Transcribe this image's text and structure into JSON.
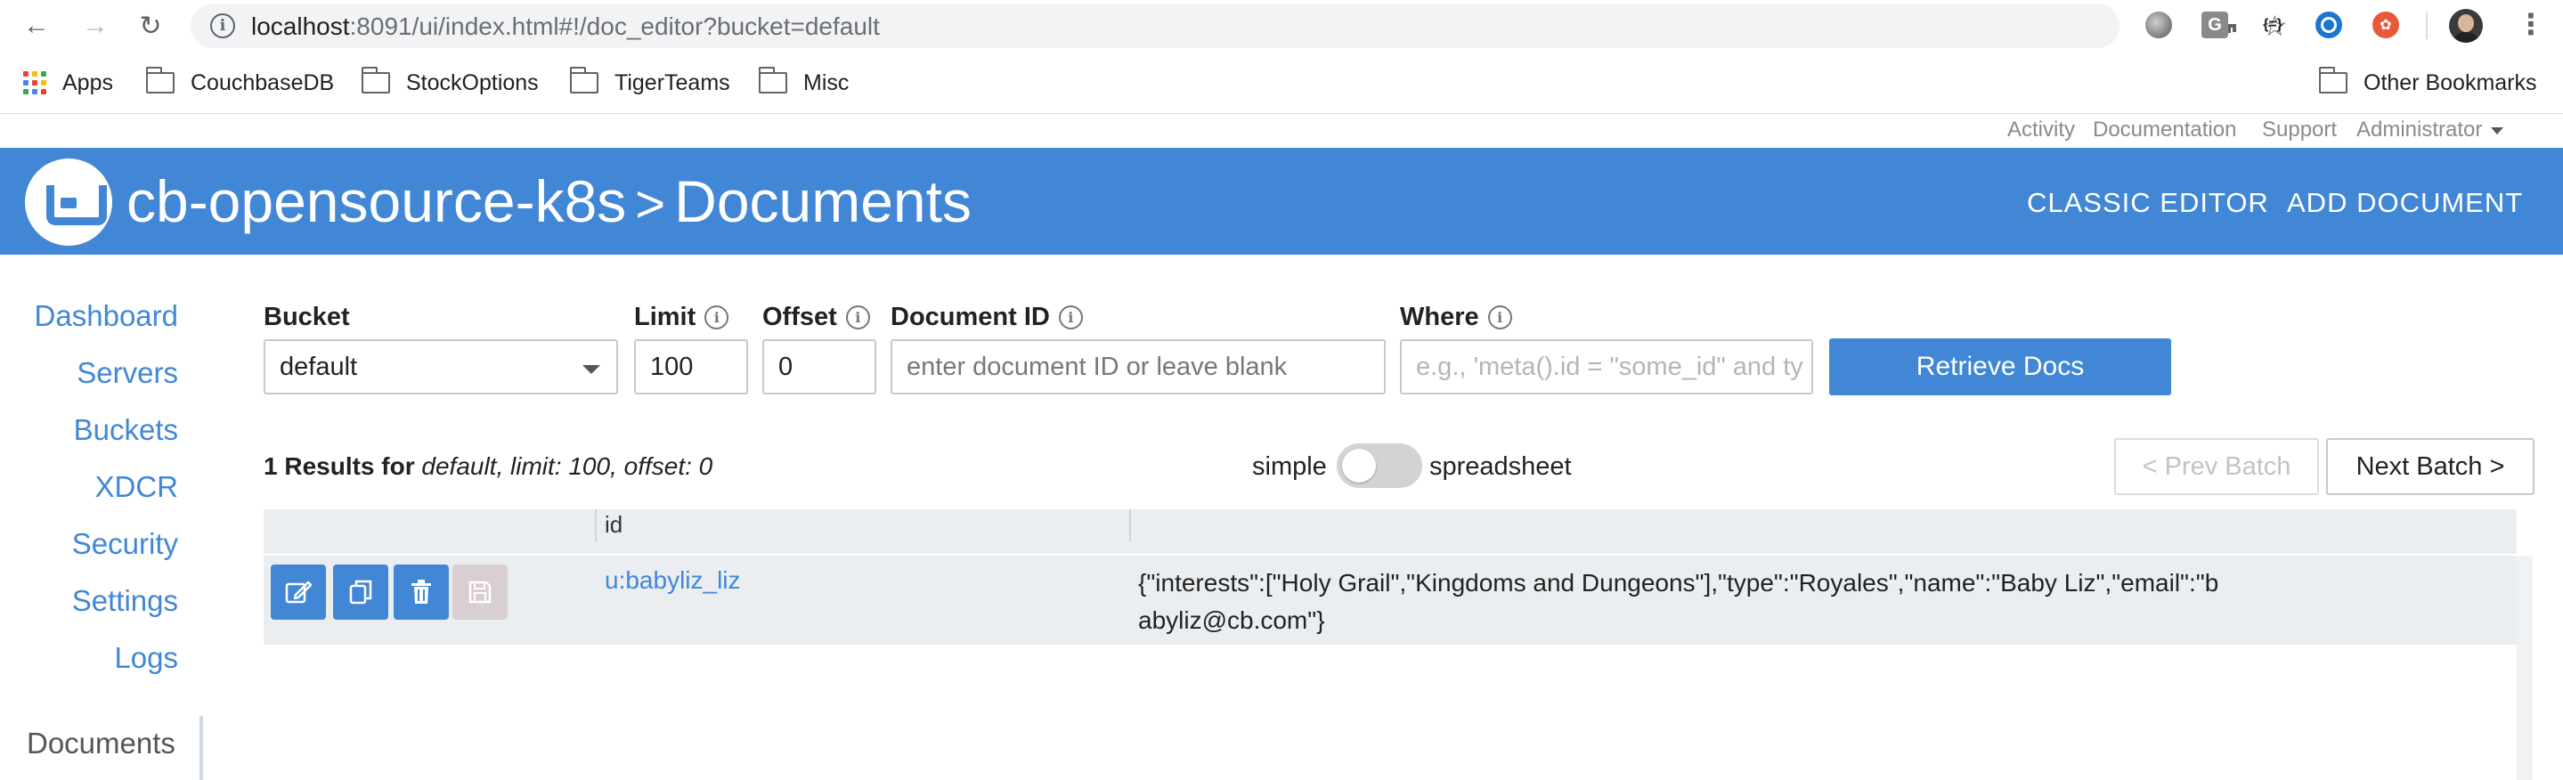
{
  "browser": {
    "url_host": "localhost",
    "url_rest": ":8091/ui/index.html#!/doc_editor?bucket=default",
    "bookmarks": [
      {
        "label": "Apps",
        "icon": "apps-grid-icon"
      },
      {
        "label": "CouchbaseDB",
        "icon": "folder-icon"
      },
      {
        "label": "StockOptions",
        "icon": "folder-icon"
      },
      {
        "label": "TigerTeams",
        "icon": "folder-icon"
      },
      {
        "label": "Misc",
        "icon": "folder-icon"
      }
    ],
    "other_bookmarks": "Other Bookmarks",
    "extensions": [
      "grey-circle-extension-icon",
      "g-extension-icon",
      "json-extension-icon",
      "blue-ring-extension-icon",
      "red-extension-icon"
    ],
    "ext_labels": {
      "g": "G",
      "json": "{=}"
    }
  },
  "utility_links": {
    "activity": "Activity",
    "documentation": "Documentation",
    "support": "Support",
    "administrator": "Administrator"
  },
  "header": {
    "cluster_name": "cb-opensource-k8s",
    "separator": ">",
    "page_title": "Documents",
    "classic_editor": "CLASSIC EDITOR",
    "add_document": "ADD DOCUMENT",
    "brand_color": "#4287d6"
  },
  "nav": {
    "items": [
      "Dashboard",
      "Servers",
      "Buckets",
      "XDCR",
      "Security",
      "Settings",
      "Logs"
    ],
    "current": "Documents"
  },
  "filters": {
    "bucket_label": "Bucket",
    "bucket_value": "default",
    "limit_label": "Limit",
    "limit_value": "100",
    "offset_label": "Offset",
    "offset_value": "0",
    "docid_label": "Document ID",
    "docid_placeholder": "enter document ID or leave blank",
    "where_label": "Where",
    "where_placeholder": "e.g., 'meta().id = \"some_id\" and ty",
    "retrieve_label": "Retrieve Docs"
  },
  "results": {
    "count_text": "1 Results for",
    "query_text": "default, limit: 100, offset: 0",
    "toggle_left": "simple",
    "toggle_right": "spreadsheet",
    "toggle_on": false,
    "prev_batch": "< Prev Batch",
    "next_batch": "Next Batch >"
  },
  "table": {
    "columns": [
      "",
      "id",
      ""
    ],
    "rows": [
      {
        "id": "u:babyliz_liz",
        "json": "{\"interests\":[\"Holy Grail\",\"Kingdoms and Dungeons\"],\"type\":\"Royales\",\"name\":\"Baby Liz\",\"email\":\"babyliz@cb.com\"}",
        "actions": [
          "edit-icon",
          "copy-icon",
          "delete-icon",
          "save-icon"
        ]
      }
    ]
  }
}
